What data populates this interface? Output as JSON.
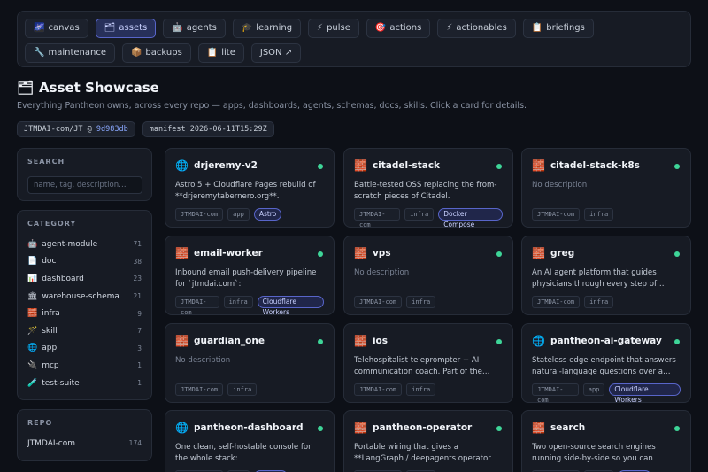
{
  "nav": [
    {
      "icon": "🌌",
      "label": "canvas",
      "active": false
    },
    {
      "icon": "🗂",
      "label": "assets",
      "active": true
    },
    {
      "icon": "🤖",
      "label": "agents",
      "active": false
    },
    {
      "icon": "🎓",
      "label": "learning",
      "active": false
    },
    {
      "icon": "⚡",
      "label": "pulse",
      "active": false
    },
    {
      "icon": "🎯",
      "label": "actions",
      "active": false
    },
    {
      "icon": "⚡",
      "label": "actionables",
      "active": false
    },
    {
      "icon": "📋",
      "label": "briefings",
      "active": false
    },
    {
      "icon": "🔧",
      "label": "maintenance",
      "active": false
    },
    {
      "icon": "📦",
      "label": "backups",
      "active": false
    },
    {
      "icon": "📋",
      "label": "lite",
      "active": false
    },
    {
      "icon": "",
      "label": "JSON ↗",
      "active": false
    }
  ],
  "page": {
    "icon": "🗂",
    "title": "Asset Showcase",
    "subtitle": "Everything Pantheon owns, across every repo — apps, dashboards, agents, schemas, docs, skills. Click a card for details.",
    "repo_chip_prefix": "JTMDAI-com/JT @ ",
    "repo_chip_hash": "9d983db",
    "manifest_chip": "manifest 2026-06-11T15:29Z"
  },
  "search": {
    "title": "SEARCH",
    "placeholder": "name, tag, description…"
  },
  "category": {
    "title": "CATEGORY",
    "items": [
      {
        "icon": "🤖",
        "label": "agent-module",
        "count": "71"
      },
      {
        "icon": "📄",
        "label": "doc",
        "count": "38"
      },
      {
        "icon": "📊",
        "label": "dashboard",
        "count": "23"
      },
      {
        "icon": "🏛",
        "label": "warehouse-schema",
        "count": "21"
      },
      {
        "icon": "🧱",
        "label": "infra",
        "count": "9"
      },
      {
        "icon": "🪄",
        "label": "skill",
        "count": "7"
      },
      {
        "icon": "🌐",
        "label": "app",
        "count": "3"
      },
      {
        "icon": "🔌",
        "label": "mcp",
        "count": "1"
      },
      {
        "icon": "🧪",
        "label": "test-suite",
        "count": "1"
      }
    ]
  },
  "repo": {
    "title": "REPO",
    "items": [
      {
        "label": "JTMDAI-com",
        "count": "174"
      }
    ]
  },
  "status_color": "#3ed598",
  "cards": [
    {
      "icon": "🌐",
      "title": "drjeremy-v2",
      "desc": "Astro 5 + Cloudflare Pages rebuild of **drjeremytabernero.org**.",
      "empty": false,
      "tags": [
        "JTMDAI-com",
        "app"
      ],
      "tech": "Astro"
    },
    {
      "icon": "🧱",
      "title": "citadel-stack",
      "desc": "Battle-tested OSS replacing the from-scratch pieces of Citadel.",
      "empty": false,
      "tags": [
        "JTMDAI-com",
        "infra"
      ],
      "tech": "Docker Compose"
    },
    {
      "icon": "🧱",
      "title": "citadel-stack-k8s",
      "desc": "No description",
      "empty": true,
      "tags": [
        "JTMDAI-com",
        "infra"
      ],
      "tech": ""
    },
    {
      "icon": "🧱",
      "title": "email-worker",
      "desc": "Inbound email push-delivery pipeline for `jtmdai.com`:",
      "empty": false,
      "tags": [
        "JTMDAI-com",
        "infra"
      ],
      "tech": "Cloudflare Workers"
    },
    {
      "icon": "🧱",
      "title": "vps",
      "desc": "No description",
      "empty": true,
      "tags": [
        "JTMDAI-com",
        "infra"
      ],
      "tech": ""
    },
    {
      "icon": "🧱",
      "title": "greg",
      "desc": "An AI agent platform that guides physicians through every step of…",
      "empty": false,
      "tags": [
        "JTMDAI-com",
        "infra"
      ],
      "tech": ""
    },
    {
      "icon": "🧱",
      "title": "guardian_one",
      "desc": "No description",
      "empty": true,
      "tags": [
        "JTMDAI-com",
        "infra"
      ],
      "tech": ""
    },
    {
      "icon": "🧱",
      "title": "ios",
      "desc": "Telehospitalist teleprompter + AI communication coach. Part of the…",
      "empty": false,
      "tags": [
        "JTMDAI-com",
        "infra"
      ],
      "tech": ""
    },
    {
      "icon": "🌐",
      "title": "pantheon-ai-gateway",
      "desc": "Stateless edge endpoint that answers natural-language questions over a…",
      "empty": false,
      "tags": [
        "JTMDAI-com",
        "app"
      ],
      "tech": "Cloudflare Workers"
    },
    {
      "icon": "🌐",
      "title": "pantheon-dashboard",
      "desc": "One clean, self-hostable console for the whole stack:",
      "empty": false,
      "tags": [
        "JTMDAI-com",
        "app"
      ],
      "tech": "Next.js"
    },
    {
      "icon": "🧱",
      "title": "pantheon-operator",
      "desc": "Portable wiring that gives a **LangGraph / deepagents operator agent** access t…",
      "empty": false,
      "tags": [
        "JTMDAI-com",
        "infra"
      ],
      "tech": ""
    },
    {
      "icon": "🧱",
      "title": "search",
      "desc": "Two open-source search engines running side-by-side so you can evaluate which…",
      "empty": false,
      "tags": [
        "JTMDAI-com",
        "infra"
      ],
      "tech": "Python"
    }
  ]
}
